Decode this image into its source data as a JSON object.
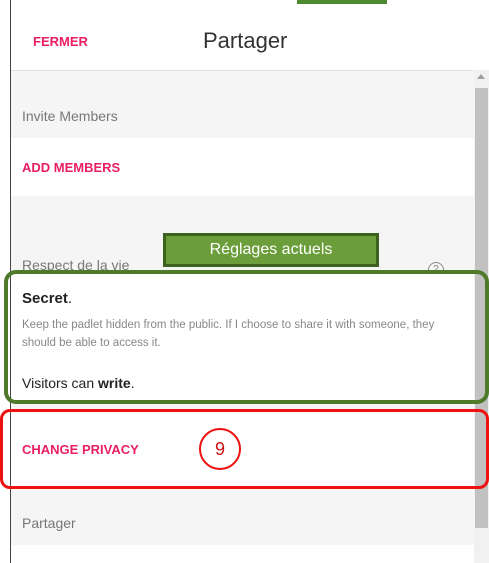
{
  "header": {
    "close_label": "FERMER",
    "title": "Partager"
  },
  "invite": {
    "section_label": "Invite Members",
    "add_members_label": "ADD MEMBERS"
  },
  "privacy": {
    "section_label": "Respect de la vie",
    "help_icon": "help-circle-icon",
    "current_name": "Secret",
    "current_suffix": ".",
    "description": "Keep the padlet hidden from the public. If I choose to share it with someone, they should be able to access it.",
    "visitors_prefix": "Visitors can ",
    "visitors_permission": "write",
    "visitors_suffix": ".",
    "change_label": "CHANGE PRIVACY"
  },
  "share": {
    "section_label": "Partager"
  },
  "callouts": {
    "current_settings_label": "Réglages actuels",
    "step_number": "9"
  },
  "colors": {
    "accent": "#e91e63",
    "callout_green": "#6b9e3a",
    "callout_red": "#ee1111"
  }
}
